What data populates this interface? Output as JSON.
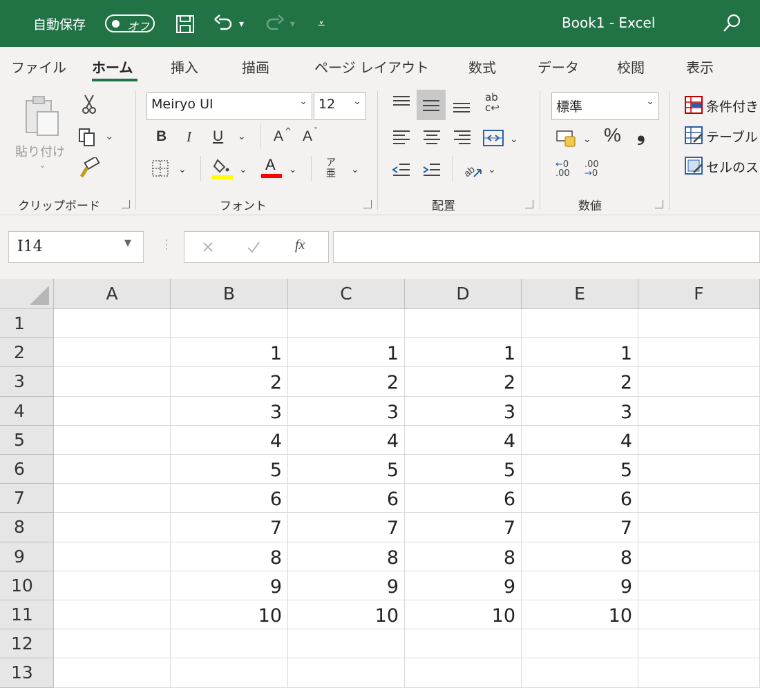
{
  "titlebar": {
    "autosave_label": "自動保存",
    "toggle_label": "オフ",
    "title": "Book1  -  Excel",
    "background": "#217346"
  },
  "tabs": [
    {
      "label": "ファイル",
      "active": false
    },
    {
      "label": "ホーム",
      "active": true
    },
    {
      "label": "挿入",
      "active": false
    },
    {
      "label": "描画",
      "active": false
    },
    {
      "label": "ページ レイアウト",
      "active": false
    },
    {
      "label": "数式",
      "active": false
    },
    {
      "label": "データ",
      "active": false
    },
    {
      "label": "校閲",
      "active": false
    },
    {
      "label": "表示",
      "active": false
    }
  ],
  "ribbon": {
    "clipboard": {
      "paste_label": "貼り付け",
      "group_label": "クリップボード"
    },
    "font": {
      "font_name": "Meiryo UI",
      "font_size": "12",
      "bold": "B",
      "italic": "I",
      "underline": "U",
      "grow": "A",
      "shrink": "A",
      "font_color_letter": "A",
      "phonetic": "ア",
      "group_label": "フォント",
      "highlight_color": "#ffff00",
      "font_color": "#ff0000"
    },
    "alignment": {
      "group_label": "配置"
    },
    "number": {
      "format": "標準",
      "percent": "%",
      "comma": "❟",
      "group_label": "数値"
    },
    "styles": {
      "conditional": "条件付き",
      "table": "テーブル",
      "cell_styles": "セルのス"
    }
  },
  "formula_bar": {
    "name_box": "I14",
    "fx": "fx",
    "value": ""
  },
  "sheet": {
    "columns": [
      "A",
      "B",
      "C",
      "D",
      "E",
      "F"
    ],
    "rows": [
      "1",
      "2",
      "3",
      "4",
      "5",
      "6",
      "7",
      "8",
      "9",
      "10",
      "11",
      "12",
      "13"
    ],
    "cells": [
      [
        "",
        "",
        "",
        "",
        "",
        ""
      ],
      [
        "",
        "1",
        "1",
        "1",
        "1",
        ""
      ],
      [
        "",
        "2",
        "2",
        "2",
        "2",
        ""
      ],
      [
        "",
        "3",
        "3",
        "3",
        "3",
        ""
      ],
      [
        "",
        "4",
        "4",
        "4",
        "4",
        ""
      ],
      [
        "",
        "5",
        "5",
        "5",
        "5",
        ""
      ],
      [
        "",
        "6",
        "6",
        "6",
        "6",
        ""
      ],
      [
        "",
        "7",
        "7",
        "7",
        "7",
        ""
      ],
      [
        "",
        "8",
        "8",
        "8",
        "8",
        ""
      ],
      [
        "",
        "9",
        "9",
        "9",
        "9",
        ""
      ],
      [
        "",
        "10",
        "10",
        "10",
        "10",
        ""
      ],
      [
        "",
        "",
        "",
        "",
        "",
        ""
      ],
      [
        "",
        "",
        "",
        "",
        "",
        ""
      ]
    ]
  }
}
